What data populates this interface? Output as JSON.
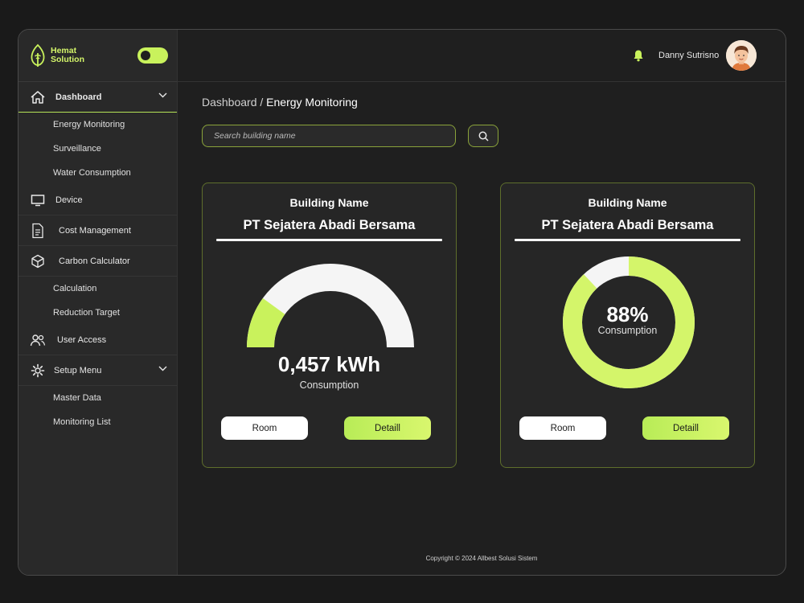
{
  "brand": {
    "line1": "Hemat",
    "line2": "Solution",
    "accent": "#c9f25c"
  },
  "sidebar": {
    "items": [
      {
        "label": "Dashboard",
        "icon": "home-icon",
        "active": true,
        "expandable": true,
        "children": [
          "Energy Monitoring",
          "Surveillance",
          "Water Consumption"
        ]
      },
      {
        "label": "Device",
        "icon": "monitor-icon"
      },
      {
        "label": "Cost Management",
        "icon": "document-icon"
      },
      {
        "label": "Carbon Calculator",
        "icon": "cube-icon",
        "children": [
          "Calculation",
          "Reduction Target"
        ]
      },
      {
        "label": "User Access",
        "icon": "users-icon"
      },
      {
        "label": "Setup Menu",
        "icon": "gear-icon",
        "expandable": true,
        "children": [
          "Master Data",
          "Monitoring List"
        ]
      }
    ]
  },
  "topbar": {
    "username": "Danny Sutrisno",
    "bell_icon": "bell-icon",
    "avatar": "avatar"
  },
  "breadcrumb": {
    "root": "Dashboard",
    "separator": " / ",
    "current": "Energy Monitoring"
  },
  "search": {
    "placeholder": "Search building name",
    "icon": "search-icon"
  },
  "cards": [
    {
      "label": "Building Name",
      "name": "PT Sejatera Abadi Bersama",
      "value": "0,457 kWh",
      "sublabel": "Consumption",
      "gauge_fraction": 0.2,
      "room_label": "Room",
      "detail_label": "Detaill"
    },
    {
      "label": "Building Name",
      "name": "PT Sejatera Abadi Bersama",
      "value": "88%",
      "sublabel": "Consumption",
      "donut_fraction": 0.88,
      "room_label": "Room",
      "detail_label": "Detaill"
    }
  ],
  "colors": {
    "accent": "#c9f25c",
    "track": "#f5f5f5",
    "card_border": "#5e6e2c"
  },
  "footer": {
    "copyright": "Copyright © 2024 Allbest Solusi Sistem"
  }
}
